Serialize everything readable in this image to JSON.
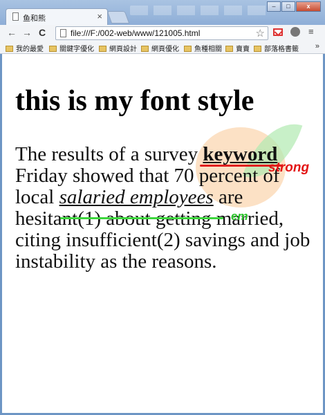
{
  "window": {
    "tab_title": "鱼和熊",
    "tab_close": "×",
    "minimize": "–",
    "maximize": "□",
    "close": "x"
  },
  "toolbar": {
    "back": "←",
    "forward": "→",
    "reload": "C",
    "url": "file:///F:/002-web/www/121005.html",
    "star": "☆",
    "menu": "≡"
  },
  "bookmarks": {
    "items": [
      "我的最愛",
      "關鍵字優化",
      "網頁設計",
      "網頁優化",
      "魚種相關",
      "賣賣",
      "部落格書籤"
    ],
    "more": "»"
  },
  "page": {
    "heading": "this is my font style",
    "para_1": "The results of a survey ",
    "keyword": "keyword",
    "para_2": " Friday showed that 70 percent of local ",
    "emphasis": "salaried employees",
    "para_3": " are hesitant(1) about getting married, citing insufficient(2) savings and job instability as the reasons."
  },
  "annotations": {
    "strong_label": "strong",
    "strong_color": "#e31515",
    "em_label": "em",
    "em_color": "#2cc42c"
  }
}
